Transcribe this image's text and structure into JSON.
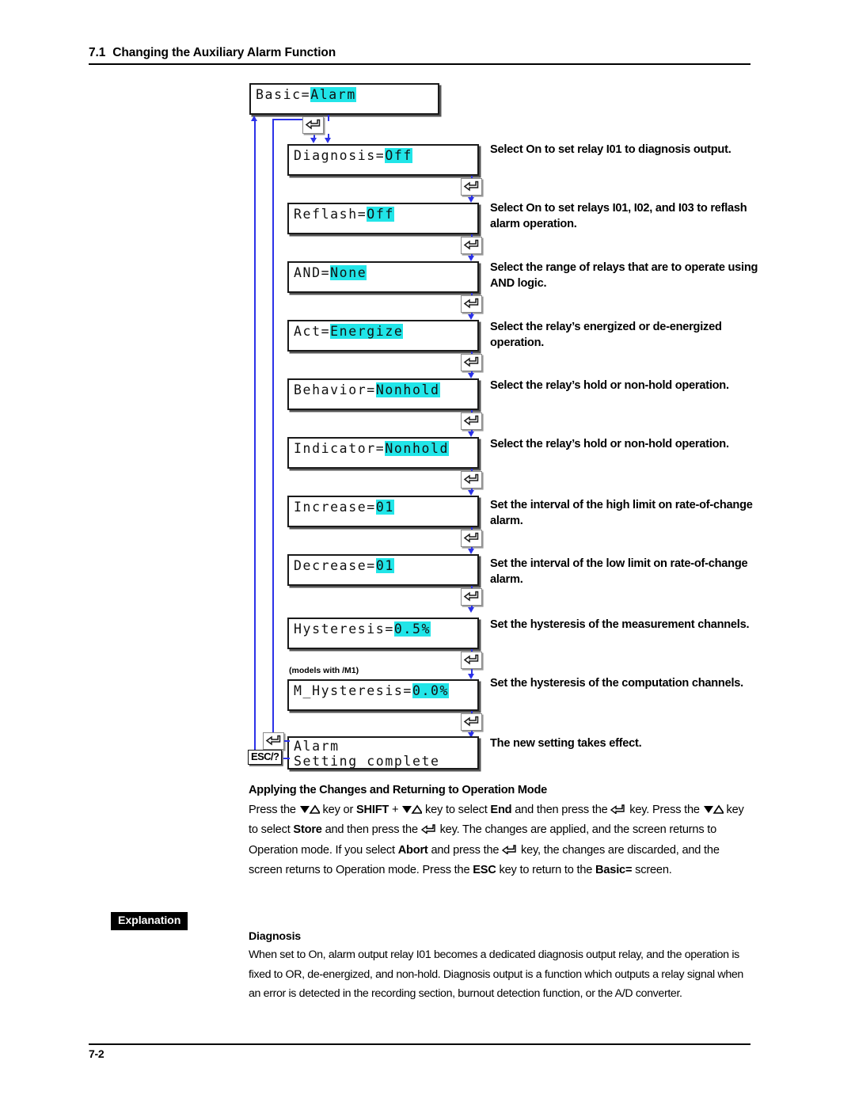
{
  "header": {
    "section_number": "7.1",
    "title": "Changing the Auxiliary Alarm Function"
  },
  "flow": {
    "top_screen": {
      "label": "Basic=",
      "value": "Alarm"
    },
    "note_m1": "(models with /M1)",
    "esc_key_label": "ESC/?",
    "enter_key_icon": "enter-key-icon",
    "steps": [
      {
        "label": "Diagnosis=",
        "value": "Off",
        "desc": "Select On to set relay I01 to diagnosis output."
      },
      {
        "label": "Reflash=",
        "value": "Off",
        "desc": "Select On to set relays I01, I02, and I03 to reflash alarm operation."
      },
      {
        "label": "AND=",
        "value": "None",
        "desc": "Select the range of relays that are to operate using AND logic."
      },
      {
        "label": "Act=",
        "value": "Energize",
        "desc": "Select the relay’s energized or de-energized operation."
      },
      {
        "label": "Behavior=",
        "value": "Nonhold",
        "desc": "Select the relay’s hold or non-hold operation."
      },
      {
        "label": "Indicator=",
        "value": "Nonhold",
        "desc": "Select the relay’s hold or non-hold operation."
      },
      {
        "label": "Increase=",
        "value": "01",
        "desc": "Set the interval of the high limit on rate-of-change alarm."
      },
      {
        "label": "Decrease=",
        "value": "01",
        "desc": "Set the interval of the low limit on rate-of-change alarm."
      },
      {
        "label": "Hysteresis=",
        "value": "0.5%",
        "desc": "Set the hysteresis of the measurement channels."
      },
      {
        "label": "M_Hysteresis=",
        "value": "0.0%",
        "desc": "Set the hysteresis of the computation channels."
      }
    ],
    "final_screen": {
      "line1": "Alarm",
      "line2": "Setting complete",
      "desc": "The new setting takes effect."
    }
  },
  "applying": {
    "heading": "Applying the Changes and Returning to Operation Mode",
    "text_parts": {
      "p1": "Press the ",
      "p2": " key or ",
      "shift": "SHIFT",
      "p3": " + ",
      "p4": " key to select ",
      "end": "End",
      "p5": " and then press the ",
      "p6": " key.  Press the ",
      "p7": " key to select ",
      "store": "Store",
      "p8": " and then press the ",
      "p9": " key.  The changes are applied, and the screen returns to Operation mode.  If you select ",
      "abort": "Abort",
      "p10": " and press the ",
      "p11": " key, the changes are discarded, and the screen returns to Operation mode.  Press the ",
      "esc": "ESC",
      "p12": " key to return to the ",
      "basic": "Basic=",
      "p13": " screen."
    }
  },
  "explanation": {
    "tag": "Explanation",
    "heading": "Diagnosis",
    "body": "When set to On, alarm output relay I01 becomes a dedicated diagnosis output relay, and the operation is fixed to OR, de-energized, and non-hold.  Diagnosis output is a function which outputs a relay signal when an error is detected in the recording section, burnout detection function, or the A/D converter."
  },
  "footer": {
    "page_number": "7-2"
  },
  "colors": {
    "highlight": "#21E5E8",
    "connector": "#2C32E8",
    "tag_bg": "#000000"
  }
}
